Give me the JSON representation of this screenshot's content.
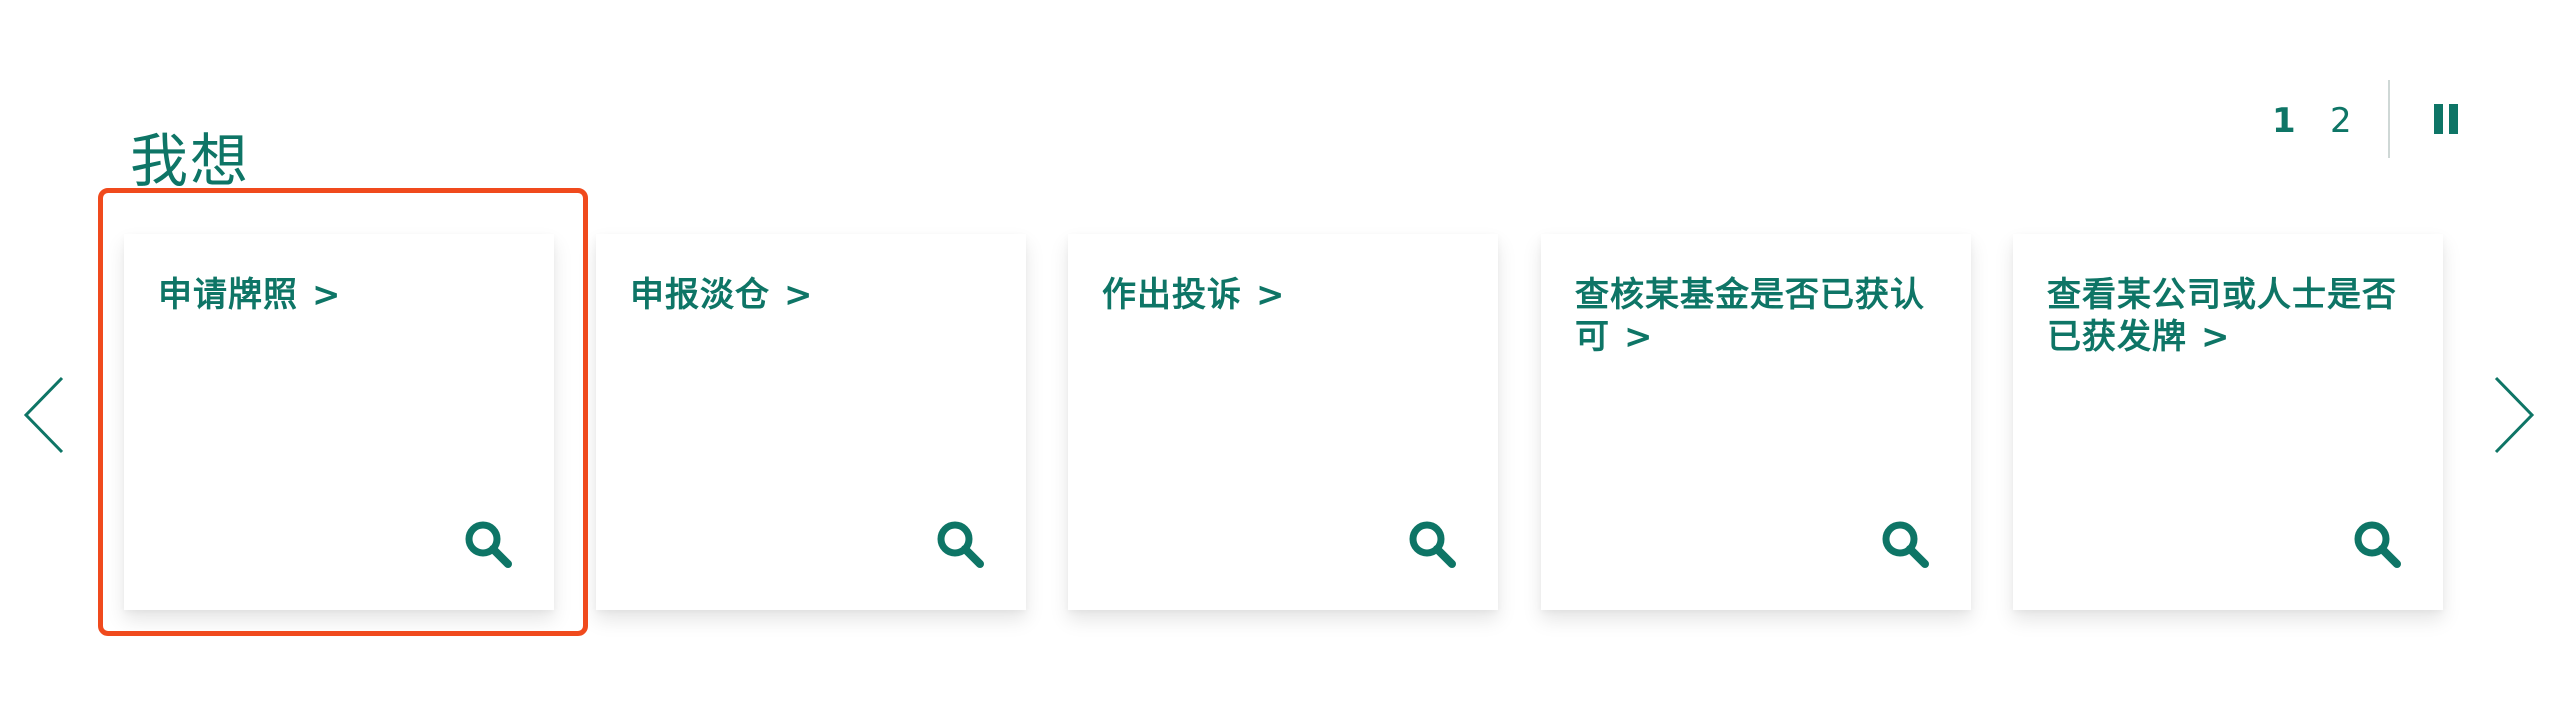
{
  "section": {
    "title": "我想"
  },
  "pager": {
    "pages": [
      "1",
      "2"
    ],
    "active_page": "1"
  },
  "cards": [
    {
      "label": "申请牌照",
      "chevron": ">"
    },
    {
      "label": "申报淡仓",
      "chevron": ">"
    },
    {
      "label": "作出投诉",
      "chevron": ">"
    },
    {
      "label": "查核某基金是否已获认可",
      "chevron": ">"
    },
    {
      "label": "查看某公司或人士是否已获发牌",
      "chevron": ">"
    }
  ],
  "icons": {
    "card_icon": "search-icon",
    "prev": "chevron-left-icon",
    "next": "chevron-right-icon",
    "pause": "pause-icon"
  },
  "colors": {
    "accent": "#0e7566",
    "highlight": "#f04a1d",
    "divider": "#cfd8d6"
  }
}
